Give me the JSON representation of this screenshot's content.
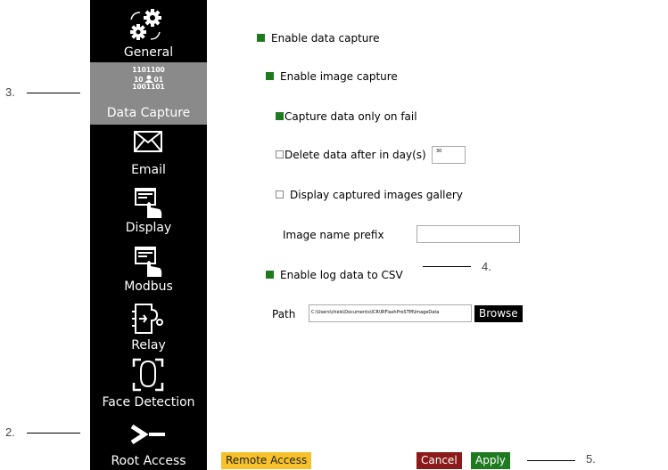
{
  "callouts": {
    "c2": "2.",
    "c3": "3.",
    "c4": "4.",
    "c5": "5."
  },
  "sidebar": {
    "items": [
      {
        "label": "General",
        "icon": "gears-icon"
      },
      {
        "label": "Data Capture",
        "icon": "binary-user-icon",
        "active": true,
        "binary": [
          "1101100",
          "10",
          "01",
          "1001101"
        ]
      },
      {
        "label": "Email",
        "icon": "envelope-icon"
      },
      {
        "label": "Display",
        "icon": "touch-display-icon"
      },
      {
        "label": "Modbus",
        "icon": "touch-display-icon"
      },
      {
        "label": "Relay",
        "icon": "relay-icon"
      },
      {
        "label": "Face Detection",
        "icon": "face-scan-icon"
      },
      {
        "label": "Root Access",
        "icon": "terminal-prompt-icon"
      }
    ]
  },
  "main": {
    "enable_data_capture": "Enable data capture",
    "enable_image_capture": "Enable image capture",
    "capture_only_on_fail": "Capture data only on fail",
    "delete_after_days": "Delete data after in day(s)",
    "delete_days_value": "30",
    "display_gallery": "Display captured images gallery",
    "image_prefix_label": "Image name prefix",
    "image_prefix_value": "",
    "enable_log_csv": "Enable log data to CSV",
    "path_label": "Path",
    "path_value": "C:\\Users\\chels\\Documents\\ICR\\IRFlashProSTM\\ImageData",
    "browse": "Browse"
  },
  "footer": {
    "remote_access": "Remote Access",
    "cancel": "Cancel",
    "apply": "Apply"
  },
  "colors": {
    "green": "#1f7a1f",
    "cancel": "#8b1a1a",
    "remote": "#f6c12b",
    "active_nav": "#8a8a8a"
  }
}
